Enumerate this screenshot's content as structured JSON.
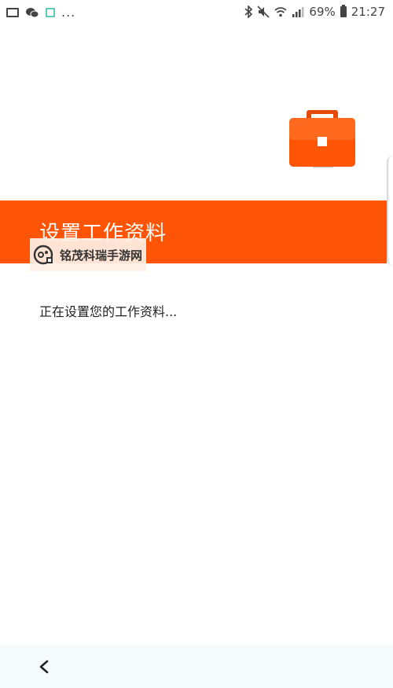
{
  "status_bar": {
    "more_indicator": "...",
    "battery": "69%",
    "time": "21:27"
  },
  "header": {
    "title": "设置工作资料"
  },
  "watermark": {
    "text": "铭茂科瑞手游网"
  },
  "main": {
    "progress_text": "正在设置您的工作资料..."
  },
  "colors": {
    "accent": "#fe5406",
    "briefcase": "#fe5406",
    "bottom_bar": "#f5fbfc"
  },
  "icons": {
    "gallery": "gallery-icon",
    "wechat": "wechat-icon",
    "qr": "qr-icon",
    "bluetooth": "bluetooth-icon",
    "mute": "mute-icon",
    "wifi": "wifi-icon",
    "signal": "signal-icon",
    "battery": "battery-icon",
    "briefcase": "briefcase-icon",
    "back": "back-chevron-icon"
  }
}
